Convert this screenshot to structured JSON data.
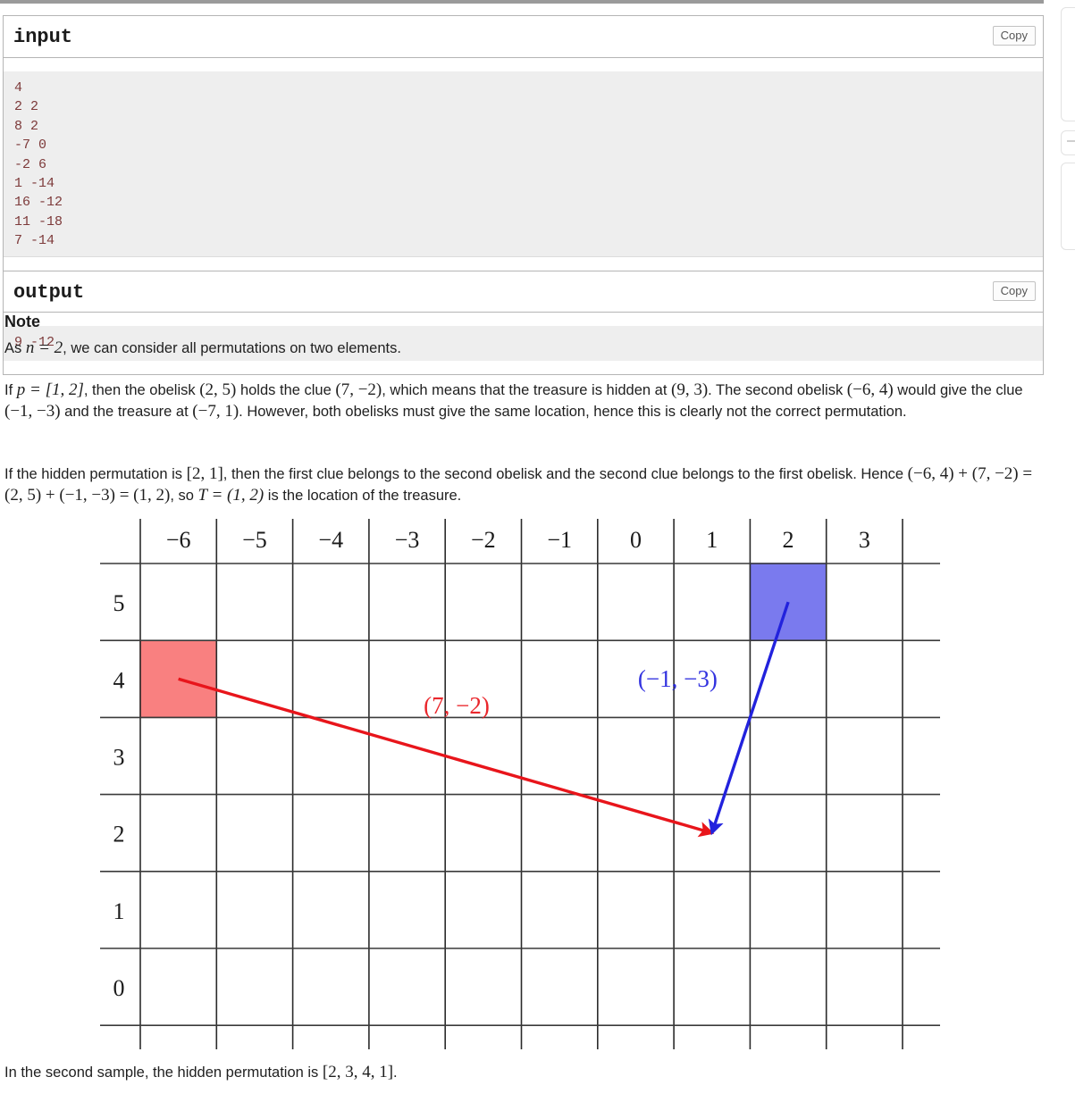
{
  "sample": {
    "input_label": "input",
    "output_label": "output",
    "copy_label": "Copy",
    "input_text": "4\n2 2\n8 2\n-7 0\n-2 6\n1 -14\n16 -12\n11 -18\n7 -14",
    "output_text": "9 -12"
  },
  "note": {
    "title": "Note",
    "p1_a": "As ",
    "p1_math": "n = 2",
    "p1_b": ", we can consider all permutations on two elements.",
    "p2_a": "If ",
    "p2_m1": "p = [1, 2]",
    "p2_b": ", then the obelisk ",
    "p2_m2": "(2, 5)",
    "p2_c": " holds the clue ",
    "p2_m3": "(7, −2)",
    "p2_d": ", which means that the treasure is hidden at ",
    "p2_m4": "(9, 3)",
    "p2_e": ". The second obelisk ",
    "p2_m5": "(−6, 4)",
    "p2_f": " would give the clue ",
    "p2_m6": "(−1, −3)",
    "p2_g": " and the treasure at ",
    "p2_m7": "(−7, 1)",
    "p2_h": ". However, both obelisks must give the same location, hence this is clearly not the correct permutation.",
    "p3_a": "If the hidden permutation is ",
    "p3_m1": "[2, 1]",
    "p3_b": ", then the first clue belongs to the second obelisk and the second clue belongs to the first obelisk. Hence ",
    "p3_m2": "(−6, 4) + (7, −2) = (2, 5) + (−1, −3) = (1, 2)",
    "p3_c": ", so ",
    "p3_m3": "T = (1, 2)",
    "p3_d": " is the location of the treasure.",
    "p4_a": "In the second sample, the hidden permutation is ",
    "p4_m1": "[2, 3, 4, 1]",
    "p4_b": "."
  },
  "chart_data": {
    "type": "scatter",
    "title": "",
    "xlabel": "",
    "ylabel": "",
    "grid": true,
    "legend": "none",
    "x_tick_labels": [
      "−6",
      "−5",
      "−4",
      "−3",
      "−2",
      "−1",
      "0",
      "1",
      "2",
      "3"
    ],
    "y_tick_labels": [
      "5",
      "4",
      "3",
      "2",
      "1",
      "0"
    ],
    "xlim": [
      -6.5,
      3.5
    ],
    "ylim": [
      -0.5,
      5.5
    ],
    "cells": [
      {
        "name": "obelisk-red",
        "x": -6,
        "y": 4,
        "fill": "#f98080",
        "stroke": "#a03030"
      },
      {
        "name": "obelisk-blue",
        "x": 2,
        "y": 5,
        "fill": "#7a7aee",
        "stroke": "#2a2ab0"
      }
    ],
    "vectors": [
      {
        "name": "clue-red",
        "label": "(7, −2)",
        "color": "#e8151b",
        "from": [
          -6,
          4
        ],
        "to": [
          1,
          2
        ],
        "label_at": [
          -2.35,
          3.55
        ]
      },
      {
        "name": "clue-blue",
        "label": "(−1, −3)",
        "color": "#2222dd",
        "from": [
          2,
          5
        ],
        "to": [
          1,
          2
        ],
        "label_at": [
          0.55,
          3.9
        ]
      }
    ]
  }
}
